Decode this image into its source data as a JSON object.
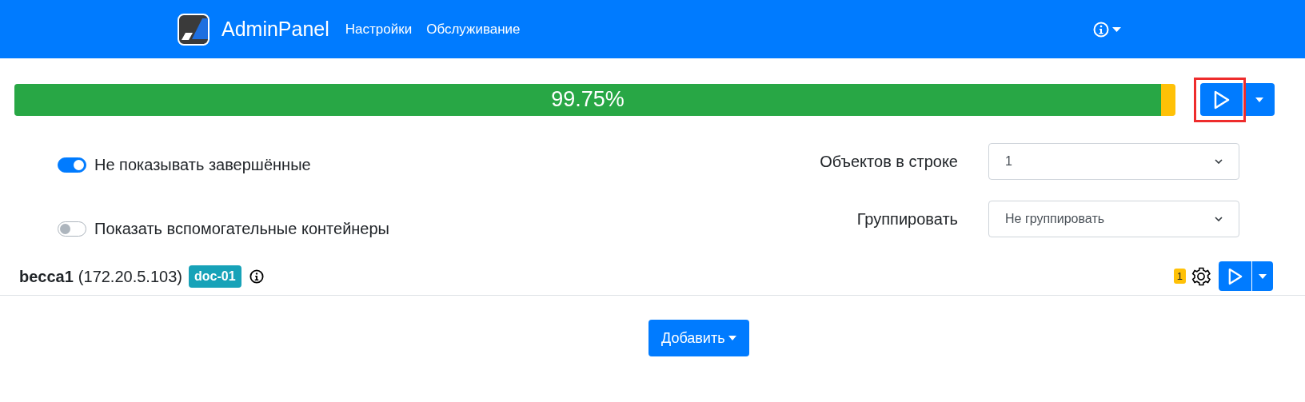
{
  "navbar": {
    "brand": "AdminPanel",
    "links": [
      "Настройки",
      "Обслуживание"
    ]
  },
  "progress": {
    "label": "99.75%",
    "segments": [
      {
        "kind": "success",
        "level": 0.9875
      },
      {
        "kind": "warning",
        "level": 0.0125
      }
    ]
  },
  "run_button": {
    "highlighted": true
  },
  "toggles": [
    {
      "label": "Не показывать завершённые",
      "on": true
    },
    {
      "label": "Показать вспомогательные контейнеры",
      "on": false
    }
  ],
  "selects": [
    {
      "label": "Объектов в строке",
      "value": "1"
    },
    {
      "label": "Группировать",
      "value": "Не группировать"
    }
  ],
  "hosts": [
    {
      "name": "becca1",
      "address": "(172.20.5.103)",
      "tag": "doc-01",
      "count": "1"
    }
  ],
  "add_button": "Добавить"
}
